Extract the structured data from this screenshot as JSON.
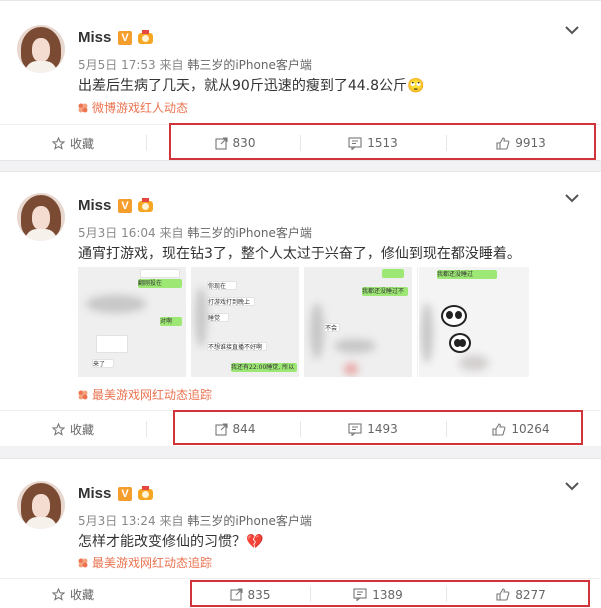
{
  "posts": [
    {
      "author": "Miss",
      "verified_badge": "V",
      "time": "5月5日 17:53",
      "source_prefix": "来自",
      "source": "韩三岁的iPhone客户端",
      "content": "出差后生病了几天，就从90斤迅速的瘦到了44.8公斤",
      "emoji": "🙄",
      "topic": "微博游戏红人动态",
      "favorite_label": "收藏",
      "reposts": "830",
      "comments": "1513",
      "likes": "9913"
    },
    {
      "author": "Miss",
      "verified_badge": "V",
      "time": "5月3日 16:04",
      "source_prefix": "来自",
      "source": "韩三岁的iPhone客户端",
      "content": "通宵打游戏，现在钻3了，整个人太过于兴奋了，修仙到现在都没睡着。",
      "images": [
        {
          "lines": [
            "翻刚投在",
            "对啊",
            "来了"
          ]
        },
        {
          "lines": [
            "你现在",
            "打游戏打到晚上",
            "睡觉",
            "不想谁接直播不好啊",
            "我还有22:00睡觉, 所以呀"
          ]
        },
        {
          "lines": [
            "睡着",
            "我都还没睡过不睡",
            "不会"
          ]
        },
        {
          "lines": [
            "我都还没睡过"
          ]
        }
      ],
      "topic": "最美游戏网红动态追踪",
      "favorite_label": "收藏",
      "reposts": "844",
      "comments": "1493",
      "likes": "10264"
    },
    {
      "author": "Miss",
      "verified_badge": "V",
      "time": "5月3日 13:24",
      "source_prefix": "来自",
      "source": "韩三岁的iPhone客户端",
      "content": "怎样才能改变修仙的习惯？",
      "emoji": "💔",
      "topic": "最美游戏网红动态追踪",
      "favorite_label": "收藏",
      "reposts": "835",
      "comments": "1389",
      "likes": "8277"
    }
  ],
  "colors": {
    "highlight": "#d0343a",
    "topic": "#eb7350",
    "badge": "#f49e2e"
  }
}
